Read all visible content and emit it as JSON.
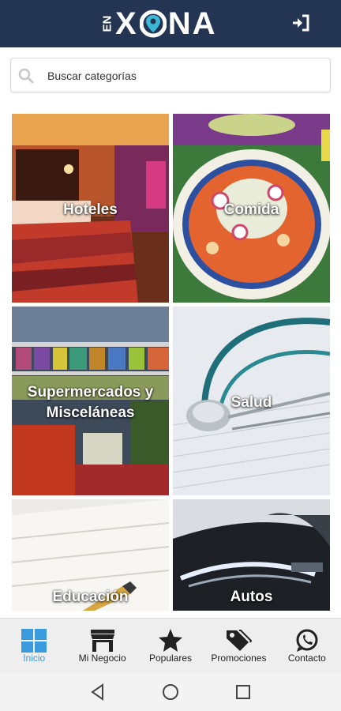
{
  "app": {
    "logo_prefix": "EN",
    "logo_letters_left": "X",
    "logo_letters_right": "NA",
    "brand_color": "#243553",
    "accent_color": "#3a9bdc"
  },
  "header": {
    "login_icon": "sign-in-icon"
  },
  "search": {
    "placeholder": "Buscar categorías",
    "icon": "search-icon"
  },
  "categories": [
    {
      "label": "Hoteles"
    },
    {
      "label": "Comida"
    },
    {
      "label": "Supermercados y\nMisceláneas"
    },
    {
      "label": "Salud"
    },
    {
      "label": "Educación"
    },
    {
      "label": "Autos"
    }
  ],
  "nav": [
    {
      "label": "Inicio",
      "icon": "grid-icon",
      "active": true
    },
    {
      "label": "Mi Negocio",
      "icon": "store-icon",
      "active": false
    },
    {
      "label": "Populares",
      "icon": "star-icon",
      "active": false
    },
    {
      "label": "Promociones",
      "icon": "tag-icon",
      "active": false
    },
    {
      "label": "Contacto",
      "icon": "whatsapp-icon",
      "active": false
    }
  ],
  "system_nav": [
    "back-icon",
    "home-icon",
    "recents-icon"
  ]
}
